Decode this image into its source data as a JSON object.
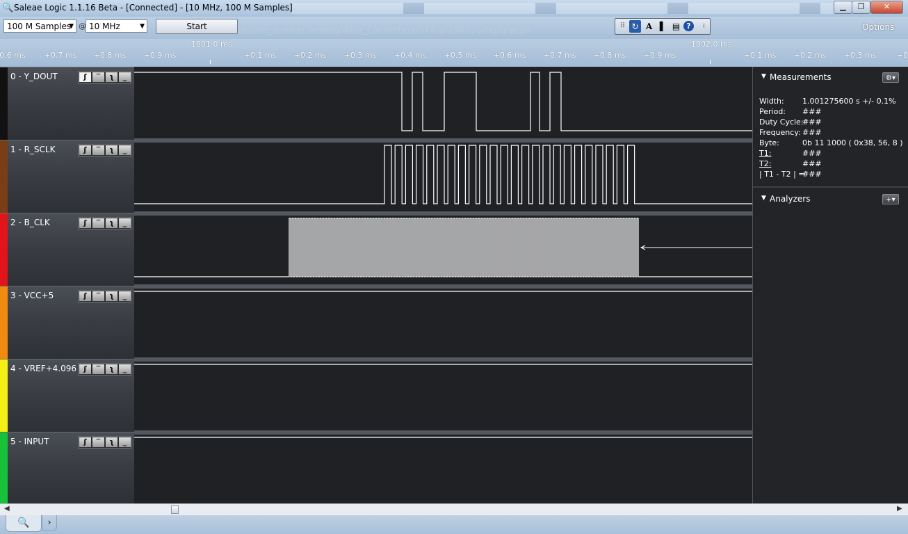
{
  "window": {
    "title": "Saleae Logic 1.1.16 Beta - [Connected] - [10 MHz, 100 M Samples]",
    "app_icon": "magnifier-icon",
    "minimize_glyph": "▁",
    "maximize_glyph": "❐",
    "close_glyph": "✕"
  },
  "toolbar": {
    "samples_value": "100 M Samples",
    "at_sign": "@",
    "rate_value": "10 MHz",
    "start_label": "Start",
    "options_label": "Options",
    "background_text": "question_answer/analog/data_converters/574/p/290736/reply.aspx",
    "tools": {
      "grip": "⠿",
      "cursor": "↻",
      "text": "A",
      "panel": "▌",
      "layout": "▤",
      "help": "?",
      "menu": "⁝"
    }
  },
  "ruler": {
    "major_labels": [
      "1001.0 ms",
      "1002.0 ms"
    ],
    "minor_labels": [
      "0.6 ms",
      "+0.7 ms",
      "+0.8 ms",
      "+0.9 ms",
      "+0.1 ms",
      "+0.2 ms",
      "+0.3 ms",
      "+0.4 ms",
      "+0.5 ms",
      "+0.6 ms",
      "+0.7 ms",
      "+0.8 ms",
      "+0.9 ms",
      "+0.1 ms",
      "+0.2 ms",
      "+0.3 ms",
      "+0"
    ]
  },
  "channels": [
    {
      "name": "0 - Y_DOUT",
      "color": "#111111"
    },
    {
      "name": "1 - R_SCLK",
      "color": "#7a3e16"
    },
    {
      "name": "2 - B_CLK",
      "color": "#e0141a"
    },
    {
      "name": "3 - VCC+5",
      "color": "#f08a10"
    },
    {
      "name": "4 - VREF+4.096",
      "color": "#f4ef14"
    },
    {
      "name": "5 - INPUT",
      "color": "#17c23a"
    }
  ],
  "trigger_glyphs": {
    "rise": "⎍",
    "high": "‾",
    "fall": "⎍",
    "low": "_"
  },
  "measurements": {
    "title": "Measurements",
    "settings_glyph": "⚙▾",
    "items": [
      {
        "label": "Width:",
        "value": "1.001275600 s +/- 0.1%"
      },
      {
        "label": "Period:",
        "value": "###"
      },
      {
        "label": "Duty Cycle:",
        "value": "###"
      },
      {
        "label": "Frequency:",
        "value": "###"
      },
      {
        "label": "Byte:",
        "value": "0b 11 1000 ( 0x38, 56, 8 )"
      },
      {
        "label": "T1:",
        "value": "###"
      },
      {
        "label": "T2:",
        "value": "###"
      },
      {
        "label": "| T1 - T2 | =",
        "value": "###"
      }
    ]
  },
  "analyzers": {
    "title": "Analyzers",
    "add_glyph": "+▾"
  },
  "bottom": {
    "search_glyph": "🔍",
    "expand_glyph": "›",
    "scroll_left": "◀",
    "scroll_right": "▶"
  }
}
